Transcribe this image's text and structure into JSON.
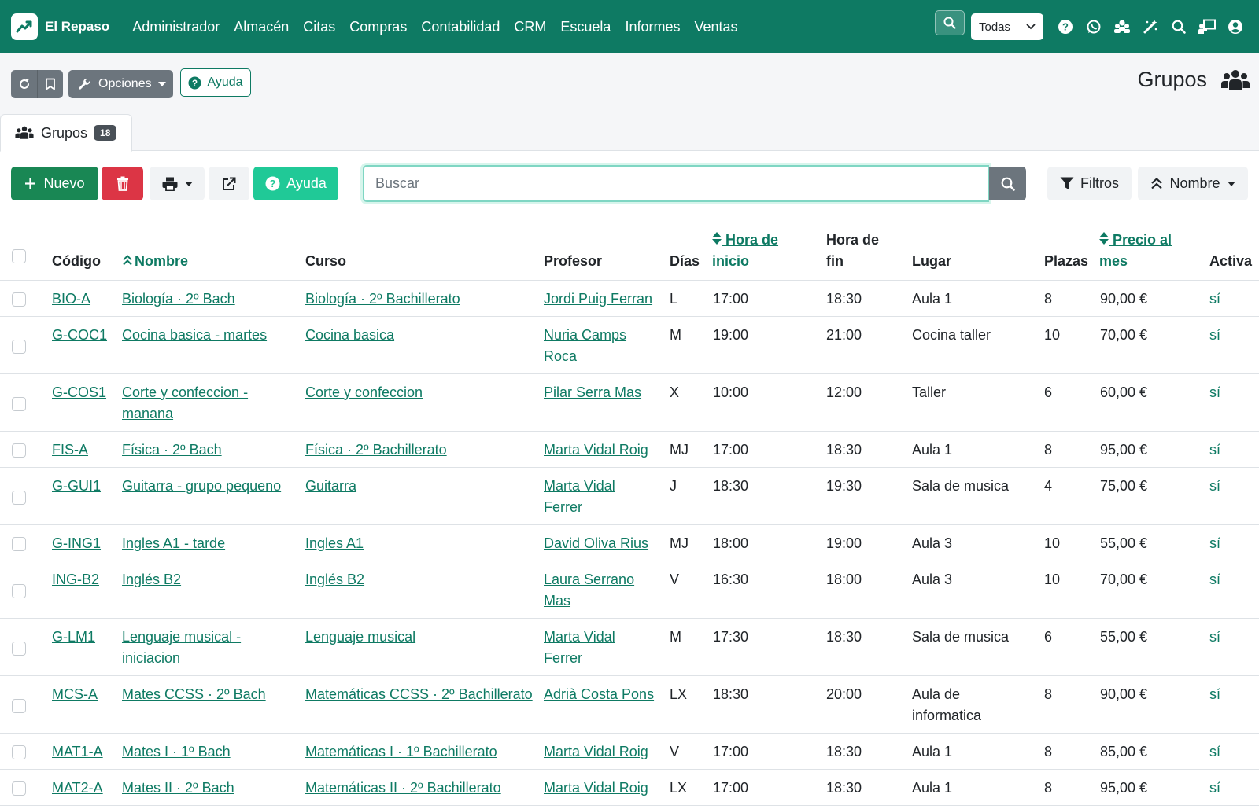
{
  "navbar": {
    "brand": "El Repaso",
    "menu": [
      "Administrador",
      "Almacén",
      "Citas",
      "Compras",
      "Contabilidad",
      "CRM",
      "Escuela",
      "Informes",
      "Ventas"
    ],
    "company_select": "Todas"
  },
  "toolbar": {
    "options_label": "Opciones",
    "help_label": "Ayuda",
    "page_title": "Grupos",
    "tab_label": "Grupos",
    "tab_count": "18"
  },
  "actions": {
    "new_label": "Nuevo",
    "help_label": "Ayuda",
    "search_placeholder": "Buscar",
    "filters_label": "Filtros",
    "sort_label": "Nombre"
  },
  "table": {
    "headers": {
      "codigo": "Código",
      "nombre": "Nombre",
      "curso": "Curso",
      "profesor": "Profesor",
      "dias": "Días",
      "hora_inicio_1": "Hora de",
      "hora_inicio_2": "inicio",
      "hora_fin_1": "Hora de",
      "hora_fin_2": "fin",
      "lugar": "Lugar",
      "plazas": "Plazas",
      "precio_1": "Precio al",
      "precio_2": "mes",
      "activa": "Activa"
    },
    "rows": [
      {
        "codigo": "BIO-A",
        "nombre": [
          "Biología · 2º Bach"
        ],
        "curso": "Biología · 2º Bachillerato",
        "profesor": [
          "Jordi Puig Ferran"
        ],
        "dias": "L",
        "inicio": "17:00",
        "fin": "18:30",
        "lugar": [
          "Aula 1"
        ],
        "plazas": "8",
        "precio": "90,00 €",
        "activa": "sí"
      },
      {
        "codigo": "G-COC1",
        "nombre": [
          "Cocina basica - martes"
        ],
        "curso": "Cocina basica",
        "profesor": [
          "Nuria Camps",
          "Roca"
        ],
        "dias": "M",
        "inicio": "19:00",
        "fin": "21:00",
        "lugar": [
          "Cocina taller"
        ],
        "plazas": "10",
        "precio": "70,00 €",
        "activa": "sí"
      },
      {
        "codigo": "G-COS1",
        "nombre": [
          "Corte y confeccion -",
          "manana"
        ],
        "curso": "Corte y confeccion",
        "profesor": [
          "Pilar Serra Mas"
        ],
        "dias": "X",
        "inicio": "10:00",
        "fin": "12:00",
        "lugar": [
          "Taller"
        ],
        "plazas": "6",
        "precio": "60,00 €",
        "activa": "sí"
      },
      {
        "codigo": "FIS-A",
        "nombre": [
          "Física · 2º Bach"
        ],
        "curso": "Física · 2º Bachillerato",
        "profesor": [
          "Marta Vidal Roig"
        ],
        "dias": "MJ",
        "inicio": "17:00",
        "fin": "18:30",
        "lugar": [
          "Aula 1"
        ],
        "plazas": "8",
        "precio": "95,00 €",
        "activa": "sí"
      },
      {
        "codigo": "G-GUI1",
        "nombre": [
          "Guitarra - grupo pequeno"
        ],
        "curso": "Guitarra",
        "profesor": [
          "Marta Vidal",
          "Ferrer"
        ],
        "dias": "J",
        "inicio": "18:30",
        "fin": "19:30",
        "lugar": [
          "Sala de musica"
        ],
        "plazas": "4",
        "precio": "75,00 €",
        "activa": "sí"
      },
      {
        "codigo": "G-ING1",
        "nombre": [
          "Ingles A1 - tarde"
        ],
        "curso": "Ingles A1",
        "profesor": [
          "David Oliva Rius"
        ],
        "dias": "MJ",
        "inicio": "18:00",
        "fin": "19:00",
        "lugar": [
          "Aula 3"
        ],
        "plazas": "10",
        "precio": "55,00 €",
        "activa": "sí"
      },
      {
        "codigo": "ING-B2",
        "nombre": [
          "Inglés B2"
        ],
        "curso": "Inglés B2",
        "profesor": [
          "Laura Serrano",
          "Mas"
        ],
        "dias": "V",
        "inicio": "16:30",
        "fin": "18:00",
        "lugar": [
          "Aula 3"
        ],
        "plazas": "10",
        "precio": "70,00 €",
        "activa": "sí"
      },
      {
        "codigo": "G-LM1",
        "nombre": [
          "Lenguaje musical -",
          "iniciacion"
        ],
        "curso": "Lenguaje musical",
        "profesor": [
          "Marta Vidal",
          "Ferrer"
        ],
        "dias": "M",
        "inicio": "17:30",
        "fin": "18:30",
        "lugar": [
          "Sala de musica"
        ],
        "plazas": "6",
        "precio": "55,00 €",
        "activa": "sí"
      },
      {
        "codigo": "MCS-A",
        "nombre": [
          "Mates CCSS · 2º Bach"
        ],
        "curso": "Matemáticas CCSS · 2º Bachillerato",
        "profesor": [
          "Adrià Costa Pons"
        ],
        "dias": "LX",
        "inicio": "18:30",
        "fin": "20:00",
        "lugar": [
          "Aula de",
          "informatica"
        ],
        "plazas": "8",
        "precio": "90,00 €",
        "activa": "sí"
      },
      {
        "codigo": "MAT1-A",
        "nombre": [
          "Mates I · 1º Bach"
        ],
        "curso": "Matemáticas I · 1º Bachillerato",
        "profesor": [
          "Marta Vidal Roig"
        ],
        "dias": "V",
        "inicio": "17:00",
        "fin": "18:30",
        "lugar": [
          "Aula 1"
        ],
        "plazas": "8",
        "precio": "85,00 €",
        "activa": "sí"
      },
      {
        "codigo": "MAT2-A",
        "nombre": [
          "Mates II · 2º Bach"
        ],
        "curso": "Matemáticas II · 2º Bachillerato",
        "profesor": [
          "Marta Vidal Roig"
        ],
        "dias": "LX",
        "inicio": "17:00",
        "fin": "18:30",
        "lugar": [
          "Aula 1"
        ],
        "plazas": "8",
        "precio": "95,00 €",
        "activa": "sí"
      }
    ]
  },
  "colors": {
    "brand": "#0e7a63",
    "danger": "#dc3545",
    "success": "#198754",
    "info": "#20c997",
    "secondary": "#6c757d"
  },
  "icons": {
    "brand": "chart-line-icon",
    "nav_search": "search-icon",
    "question": "question-circle-icon",
    "whatsapp": "whatsapp-icon",
    "users": "users-cog-icon",
    "magic": "magic-wand-icon",
    "search": "search-icon",
    "teacher": "chalkboard-teacher-icon",
    "user": "user-circle-icon",
    "refresh": "refresh-icon",
    "bookmark": "bookmark-icon",
    "wrench": "wrench-icon",
    "group": "group-icon",
    "plus": "plus-icon",
    "trash": "trash-icon",
    "print": "print-icon",
    "external": "external-link-icon",
    "filter": "filter-icon",
    "sort": "sort-icon"
  }
}
